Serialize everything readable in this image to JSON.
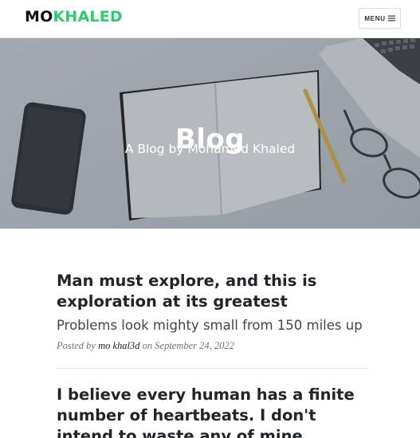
{
  "navbar": {
    "brand_part1": "MO",
    "brand_part2": "KHALED",
    "brand_accent_color": "#2ecc71",
    "menu_label": "MENU",
    "menu_icon": "hamburger-icon"
  },
  "header": {
    "title": "Blog",
    "subtitle": "A Blog by Mohamed Khaled"
  },
  "posts": [
    {
      "title": "Man must explore, and this is exploration at its greatest",
      "subtitle": "Problems look mighty small from 150 miles up",
      "meta_prefix": "Posted by",
      "author": "mo khal3d",
      "meta_date": "on September 24, 2022"
    },
    {
      "title": "I believe every human has a finite number of heartbeats. I don't intend to waste any of mine."
    }
  ]
}
